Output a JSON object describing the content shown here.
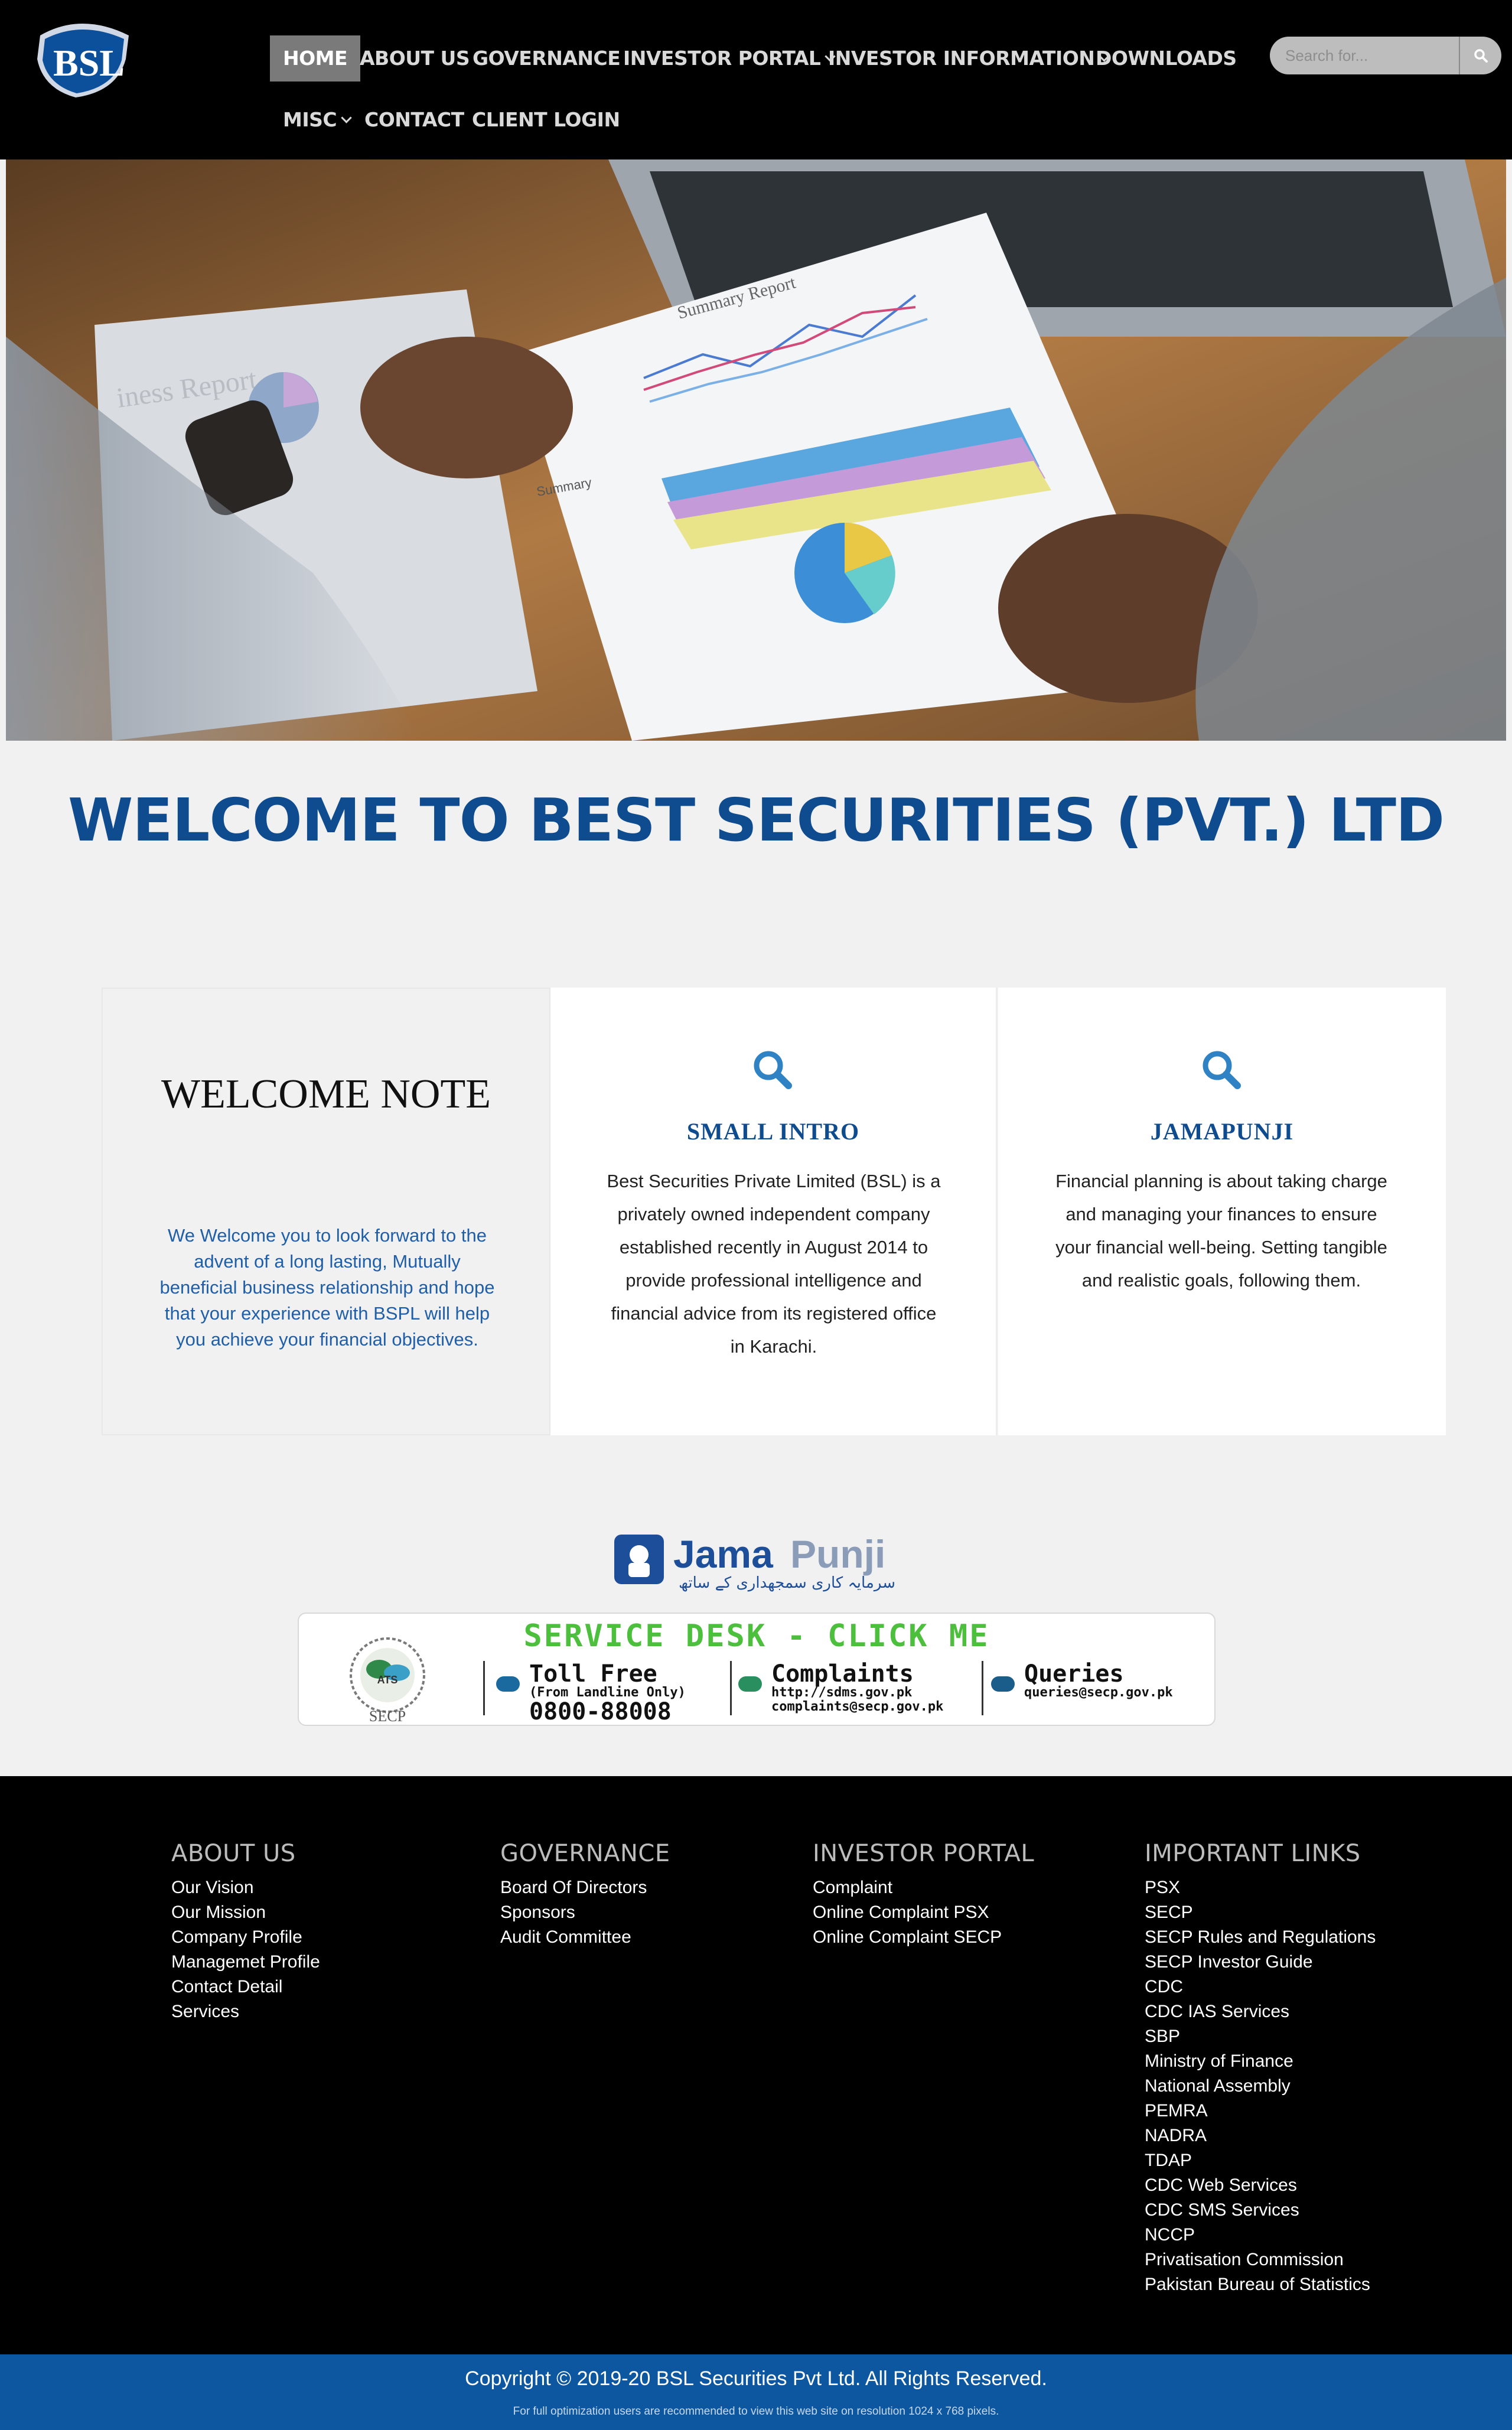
{
  "brand": {
    "logo_text": "BSL"
  },
  "nav": {
    "items": [
      {
        "label": "HOME"
      },
      {
        "label": "ABOUT US"
      },
      {
        "label": "GOVERNANCE"
      },
      {
        "label": "INVESTOR PORTAL"
      },
      {
        "label": "INVESTOR INFORMATION"
      },
      {
        "label": "DOWNLOADS"
      },
      {
        "label": "MISC"
      },
      {
        "label": "CONTACT"
      },
      {
        "label": "CLIENT LOGIN"
      }
    ]
  },
  "search": {
    "placeholder": "Search for..."
  },
  "hero": {
    "report_title": "Summary Report",
    "report_subtitle": "Summary",
    "left_paper": "iness Report"
  },
  "welcome": {
    "title": "WELCOME TO BEST SECURITIES (PVT.) LTD"
  },
  "welcome_note": {
    "title": "WELCOME NOTE",
    "text": "We Welcome you to look forward to the advent of a long lasting, Mutually beneficial business relationship and hope that your experience with BSPL will help you achieve your financial objectives."
  },
  "small_intro": {
    "heading": "SMALL INTRO",
    "text": "Best Securities Private Limited (BSL) is a privately owned independent company established recently in August 2014 to provide professional intelligence and financial advice from its registered office in Karachi."
  },
  "jamapunji": {
    "heading": "JAMAPUNJI",
    "text": "Financial planning is about taking charge and managing your finances to ensure your financial well-being. Setting tangible and realistic goals, following them."
  },
  "jamapunji_logo": {
    "word1": "Jama",
    "word2": "Punji",
    "urdu": "سرمایہ کاری سمجھداری کے ساتھ"
  },
  "service_desk": {
    "title": "SERVICE DESK - CLICK ME",
    "seal_label": "SECP",
    "seal_inner": "ATS",
    "toll_free": {
      "title": "Toll Free",
      "sub": "(From Landline Only)",
      "number": "0800-88008"
    },
    "complaints": {
      "title": "Complaints",
      "line1": "http://sdms.gov.pk",
      "line2": "complaints@secp.gov.pk"
    },
    "queries": {
      "title": "Queries",
      "line1": "queries@secp.gov.pk"
    }
  },
  "footer": {
    "columns": [
      {
        "title": "ABOUT US",
        "links": [
          "Our Vision",
          "Our Mission",
          "Company Profile",
          "Managemet Profile",
          "Contact Detail",
          "Services"
        ]
      },
      {
        "title": "GOVERNANCE",
        "links": [
          "Board Of Directors",
          "Sponsors",
          "Audit Committee"
        ]
      },
      {
        "title": "INVESTOR PORTAL",
        "links": [
          "Complaint",
          "Online Complaint PSX",
          "Online Complaint SECP"
        ]
      },
      {
        "title": "IMPORTANT LINKS",
        "links": [
          "PSX",
          "SECP",
          "SECP Rules and Regulations",
          "SECP Investor Guide",
          "CDC",
          "CDC IAS Services",
          "SBP",
          "Ministry of Finance",
          "National Assembly",
          "PEMRA",
          "NADRA",
          "TDAP",
          "CDC Web Services",
          "CDC SMS Services",
          "NCCP",
          "Privatisation Commission",
          "Pakistan Bureau of Statistics"
        ]
      }
    ],
    "copyright": "Copyright © 2019-20 BSL Securities Pvt Ltd. All Rights Reserved.",
    "note": "For full optimization users are recommended to view this web site on resolution 1024 x 768 pixels."
  },
  "colors": {
    "primary": "#0f4c8f",
    "header_bg": "#000000",
    "active_nav": "#7a7a7a",
    "service_green": "#4cbf3c",
    "footer_bar": "#0d56a0"
  }
}
